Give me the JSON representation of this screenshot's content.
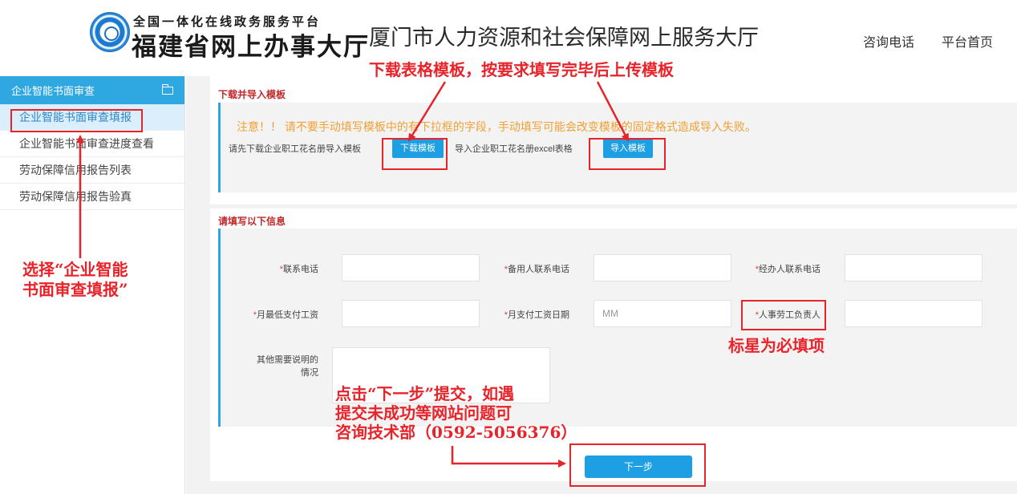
{
  "header": {
    "platform_tagline": "全国一体化在线政务服务平台",
    "platform_name": "福建省网上办事大厅",
    "site_title": "厦门市人力资源和社会保障网上服务大厅",
    "links": [
      "咨询电话",
      "平台首页"
    ]
  },
  "sidebar": {
    "header": "企业智能书面审查",
    "header_icon": "folder-icon",
    "items": [
      {
        "label": "企业智能书面审查填报",
        "active": true
      },
      {
        "label": "企业智能书面审查进度查看",
        "active": false
      },
      {
        "label": "劳动保障信用报告列表",
        "active": false
      },
      {
        "label": "劳动保障信用报告验真",
        "active": false
      }
    ]
  },
  "import_section": {
    "title": "下载并导入模板",
    "notice": "注意！！ 请不要手动填写模板中的有下拉框的字段，手动填写可能会改变模板的固定格式造成导入失败。",
    "download_prompt": "请先下载企业职工花名册导入模板",
    "download_button": "下载模板",
    "import_prompt": "导入企业职工花名册excel表格",
    "import_button": "导入模板"
  },
  "form_section": {
    "title": "请填写以下信息",
    "star": "*",
    "fields": {
      "contact_phone": "联系电话",
      "backup_phone": "备用人联系电话",
      "handler_phone": "经办人联系电话",
      "min_wage": "月最低支付工资",
      "pay_date": "月支付工资日期",
      "pay_date_placeholder": "MM",
      "hr_manager": "人事劳工负责人",
      "other_notes_line1": "其他需要说明的",
      "other_notes_line2": "情况"
    },
    "next_button": "下一步"
  },
  "annotations": {
    "template_note": "下载表格模板，按要求填写完毕后上传模板",
    "select_note_line1": "选择“企业智能",
    "select_note_line2": "书面审查填报”",
    "required_note": "标星为必填项",
    "submit_note_line1": "点击“下一步”提交，如遇",
    "submit_note_line2": "提交未成功等网站问题可",
    "submit_note_line3": "咨询技术部（0592-5056376）"
  },
  "colors": {
    "accent": "#2fa7e1",
    "button": "#1f9fe3",
    "section_title": "#c0282a",
    "notice": "#f0a035",
    "annotation": "#e8232a"
  }
}
